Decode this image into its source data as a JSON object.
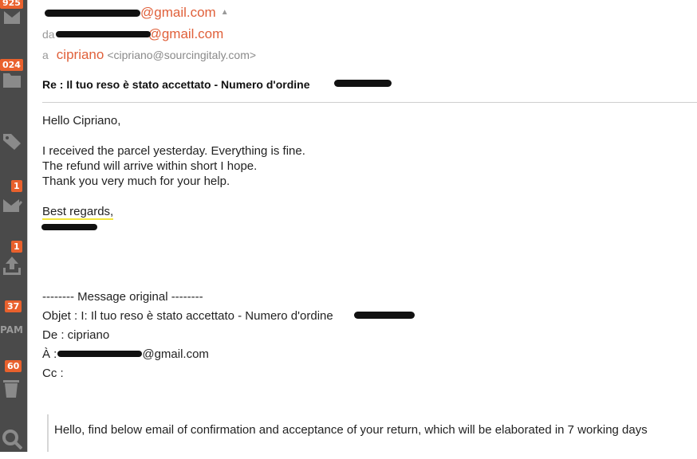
{
  "sidebar": {
    "items": [
      {
        "icon": "inbox-icon",
        "badge": "925"
      },
      {
        "icon": "folder-icon",
        "badge": "024"
      },
      {
        "icon": "tags-icon",
        "badge": ""
      },
      {
        "icon": "compose-icon",
        "badge": "1"
      },
      {
        "icon": "upload-icon",
        "badge": "1"
      },
      {
        "icon": "spam-icon",
        "badge": "37",
        "label": "PAM"
      },
      {
        "icon": "trash-icon",
        "badge": "60"
      },
      {
        "icon": "search-icon",
        "badge": ""
      }
    ],
    "accent": "#e9612d"
  },
  "header": {
    "from_suffix": "@gmail.com",
    "da_label": "da",
    "da_suffix": "@gmail.com",
    "to_label": "a",
    "to_name": "cipriano",
    "to_address": "<cipriano@sourcingitaly.com>",
    "subject": "Re : Il tuo reso è stato accettato - Numero d'ordine"
  },
  "body": {
    "greeting": "Hello Cipriano,",
    "line1": "I received the parcel yesterday. Everything is fine.",
    "line2": "The refund will arrive within short I hope.",
    "line3": "Thank you very much for your help.",
    "signoff": "Best regards,"
  },
  "original": {
    "separator": "-------- Message original --------",
    "objet": "Objet : I: Il tuo reso è stato accettato - Numero d'ordine",
    "de": "De : cipriano",
    "a_label": "À :",
    "a_suffix": "@gmail.com",
    "cc": "Cc :",
    "quoted": "Hello, find below email of confirmation and acceptance of your return, which will be elaborated in 7 working days"
  },
  "colors": {
    "sender": "#e0603a",
    "sidebar": "#4a4a4a"
  }
}
